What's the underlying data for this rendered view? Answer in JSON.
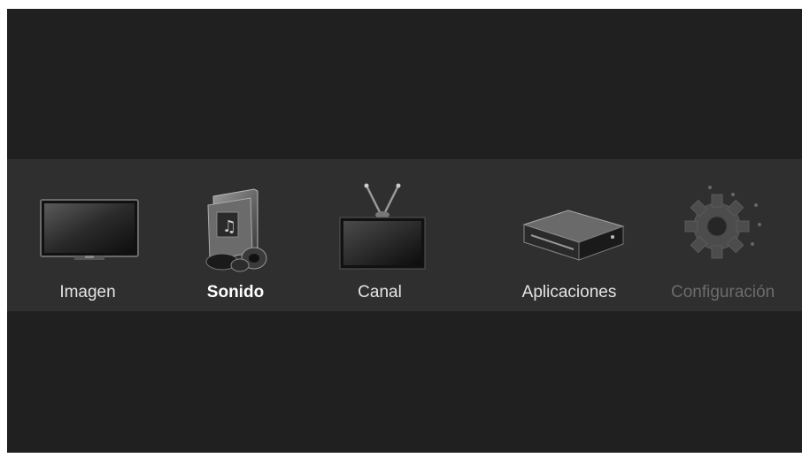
{
  "menu": {
    "items": [
      {
        "label": "Imagen",
        "icon": "monitor-icon",
        "state": "normal"
      },
      {
        "label": "Sonido",
        "icon": "music-folder-icon",
        "state": "selected"
      },
      {
        "label": "Canal",
        "icon": "tv-antenna-icon",
        "state": "normal"
      },
      {
        "label": "Aplicaciones",
        "icon": "media-box-icon",
        "state": "normal"
      },
      {
        "label": "Configuración",
        "icon": "gear-icon",
        "state": "disabled"
      }
    ]
  },
  "colors": {
    "background": "#202020",
    "menu_band": "#2f2f2f",
    "label": "#e4e4e4",
    "label_selected": "#ffffff",
    "label_disabled": "#6c6c6c"
  }
}
